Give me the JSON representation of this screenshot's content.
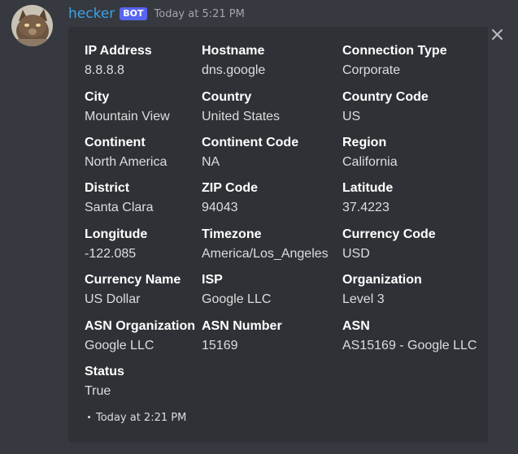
{
  "message": {
    "username": "hecker",
    "bot_tag": "BOT",
    "timestamp": "Today at 5:21 PM"
  },
  "embed": {
    "fields": [
      {
        "name": "IP Address",
        "value": "8.8.8.8"
      },
      {
        "name": "Hostname",
        "value": "dns.google"
      },
      {
        "name": "Connection Type",
        "value": "Corporate"
      },
      {
        "name": "City",
        "value": "Mountain View"
      },
      {
        "name": "Country",
        "value": "United States"
      },
      {
        "name": "Country Code",
        "value": "US"
      },
      {
        "name": "Continent",
        "value": "North America"
      },
      {
        "name": "Continent Code",
        "value": "NA"
      },
      {
        "name": "Region",
        "value": "California"
      },
      {
        "name": "District",
        "value": "Santa Clara"
      },
      {
        "name": "ZIP Code",
        "value": "94043"
      },
      {
        "name": "Latitude",
        "value": "37.4223"
      },
      {
        "name": "Longitude",
        "value": "-122.085"
      },
      {
        "name": "Timezone",
        "value": "America/Los_Angeles"
      },
      {
        "name": "Currency Code",
        "value": "USD"
      },
      {
        "name": "Currency Name",
        "value": "US Dollar"
      },
      {
        "name": "ISP",
        "value": "Google LLC"
      },
      {
        "name": "Organization",
        "value": "Level 3"
      },
      {
        "name": "ASN Organization",
        "value": "Google LLC"
      },
      {
        "name": "ASN Number",
        "value": "15169"
      },
      {
        "name": "ASN",
        "value": "AS15169 - Google LLC"
      },
      {
        "name": "Status",
        "value": "True"
      }
    ],
    "footer_timestamp": "Today at 2:21 PM"
  },
  "icons": {
    "close": "close-icon",
    "avatar": "cat-avatar"
  },
  "colors": {
    "background": "#36393f",
    "embed_background": "#2f3136",
    "username": "#3ba3e6",
    "bot_tag": "#5865f2"
  }
}
